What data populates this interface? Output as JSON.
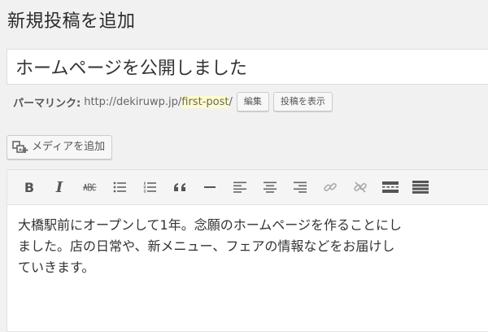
{
  "page": {
    "title": "新規投稿を追加"
  },
  "post": {
    "title": "ホームページを公開しました"
  },
  "permalink": {
    "label": "パーマリンク:",
    "base_url": "http://dekiruwp.jp/",
    "slug": "first-post",
    "trailing": "/",
    "edit_button": "編集",
    "view_button": "投稿を表示"
  },
  "media": {
    "add_media_label": "メディアを追加",
    "icon": "add-media-icon"
  },
  "toolbar": {
    "buttons": [
      {
        "name": "bold",
        "icon": "bold-icon"
      },
      {
        "name": "italic",
        "icon": "italic-icon"
      },
      {
        "name": "strikethrough",
        "icon": "strikethrough-icon"
      },
      {
        "name": "bulleted-list",
        "icon": "bulleted-list-icon"
      },
      {
        "name": "numbered-list",
        "icon": "numbered-list-icon"
      },
      {
        "name": "blockquote",
        "icon": "blockquote-icon"
      },
      {
        "name": "horizontal-line",
        "icon": "horizontal-line-icon"
      },
      {
        "name": "align-left",
        "icon": "align-left-icon"
      },
      {
        "name": "align-center",
        "icon": "align-center-icon"
      },
      {
        "name": "align-right",
        "icon": "align-right-icon"
      },
      {
        "name": "insert-link",
        "icon": "link-icon"
      },
      {
        "name": "remove-link",
        "icon": "unlink-icon"
      },
      {
        "name": "read-more",
        "icon": "read-more-icon"
      },
      {
        "name": "toolbar-toggle",
        "icon": "toolbar-toggle-icon"
      }
    ]
  },
  "editor": {
    "content": "大橋駅前にオープンして1年。念願のホームページを作ることにし\nました。店の日常や、新メニュー、フェアの情報などをお届けし\nていきます。"
  }
}
